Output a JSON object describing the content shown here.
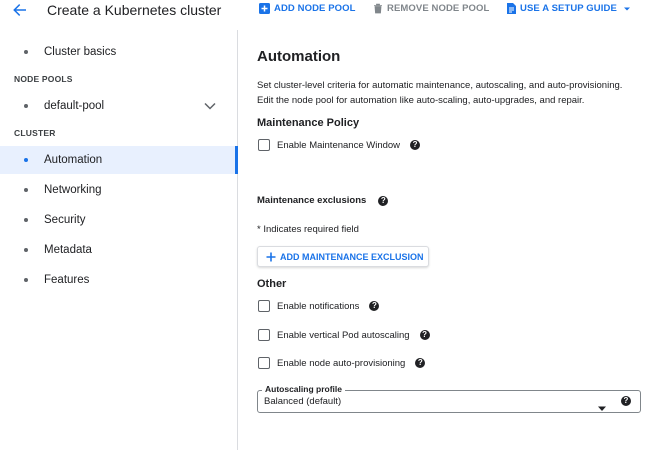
{
  "header": {
    "title": "Create a Kubernetes cluster",
    "add_node_pool": "ADD NODE POOL",
    "remove_node_pool": "REMOVE NODE POOL",
    "setup_guide": "USE A SETUP GUIDE"
  },
  "sidebar": {
    "cluster_basics": "Cluster basics",
    "node_pools_heading": "NODE POOLS",
    "default_pool": "default-pool",
    "cluster_heading": "CLUSTER",
    "items": [
      "Automation",
      "Networking",
      "Security",
      "Metadata",
      "Features"
    ],
    "active": "Automation"
  },
  "main": {
    "title": "Automation",
    "description_1": "Set cluster-level criteria for automatic maintenance, autoscaling, and auto-provisioning.",
    "description_2": "Edit the node pool for automation like auto-scaling, auto-upgrades, and repair.",
    "maintenance_policy": "Maintenance Policy",
    "enable_maintenance_window": "Enable Maintenance Window",
    "maintenance_exclusions": "Maintenance exclusions",
    "required_note": "* Indicates required field",
    "add_exclusion": "ADD MAINTENANCE EXCLUSION",
    "other": "Other",
    "enable_notifications": "Enable notifications",
    "enable_vpa": "Enable vertical Pod autoscaling",
    "enable_nap": "Enable node auto-provisioning",
    "autoscaling_profile_label": "Autoscaling profile",
    "autoscaling_profile_value": "Balanced (default)"
  },
  "colors": {
    "accent": "#1a73e8",
    "active_bg": "#e8f0fe",
    "disabled": "#80868b"
  },
  "icons": [
    "back-arrow-icon",
    "plus-icon",
    "trash-icon",
    "document-icon",
    "caret-down-icon",
    "chevron-down-icon",
    "help-icon"
  ]
}
